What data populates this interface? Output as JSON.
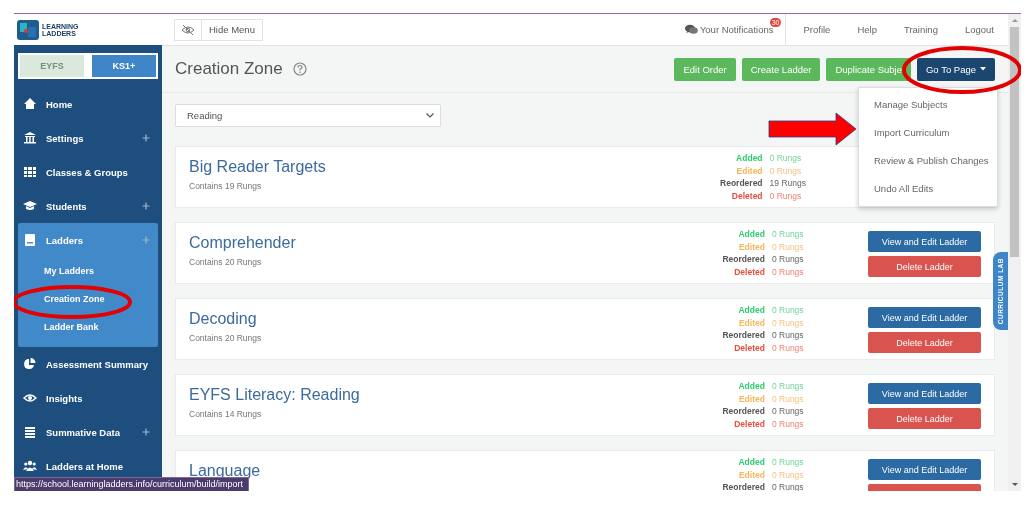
{
  "logo": {
    "line_1": "LEARNING",
    "line_2": "LADDERS"
  },
  "top_bar": {
    "hide_menu": "Hide Menu",
    "notifications": {
      "label": "Your Notifications",
      "count": "30"
    },
    "links": [
      "Profile",
      "Help",
      "Training",
      "Logout"
    ]
  },
  "stage_toggle": [
    {
      "label": "EYFS",
      "selected": false
    },
    {
      "label": "KS1+",
      "selected": true
    }
  ],
  "sidebar": {
    "items": [
      {
        "label": "Home",
        "expandable": false
      },
      {
        "label": "Settings",
        "expandable": true,
        "expanded": false
      },
      {
        "label": "Classes & Groups",
        "expandable": false
      },
      {
        "label": "Students",
        "expandable": true,
        "expanded": false
      },
      {
        "label": "Ladders",
        "expandable": true,
        "expanded": true,
        "children": [
          {
            "label": "My Ladders"
          },
          {
            "label": "Creation Zone"
          },
          {
            "label": "Ladder Bank"
          }
        ]
      },
      {
        "label": "Assessment Summary",
        "expandable": false
      },
      {
        "label": "Insights",
        "expandable": false
      },
      {
        "label": "Summative Data",
        "expandable": true,
        "expanded": false
      },
      {
        "label": "Ladders at Home",
        "expandable": false
      }
    ]
  },
  "page": {
    "title": "Creation Zone",
    "subject_select": "Reading",
    "actions": [
      {
        "kind": "green",
        "label": "Edit Order"
      },
      {
        "kind": "green",
        "label": "Create Ladder"
      },
      {
        "kind": "green",
        "label": "Duplicate Subje"
      }
    ],
    "go_to_page": {
      "label": "Go To Page",
      "expanded": true,
      "menu": [
        "Manage Subjects",
        "Import Curriculum",
        "Review & Publish Changes",
        "Undo All Edits"
      ]
    }
  },
  "ladders": [
    {
      "name": "Big Reader Targets",
      "rungs": "Contains 19 Rungs",
      "stats": [
        {
          "kind": "added",
          "label": "Added",
          "value": "0 Rungs"
        },
        {
          "kind": "edited",
          "label": "Edited",
          "value": "0 Rungs"
        },
        {
          "kind": "reordered",
          "label": "Reordered",
          "value": "19 Rungs"
        },
        {
          "kind": "deleted",
          "label": "Deleted",
          "value": "0 Rungs"
        }
      ]
    },
    {
      "name": "Comprehender",
      "rungs": "Contains 20 Rungs",
      "stats": [
        {
          "kind": "added",
          "label": "Added",
          "value": "0 Rungs"
        },
        {
          "kind": "edited",
          "label": "Edited",
          "value": "0 Rungs"
        },
        {
          "kind": "reordered",
          "label": "Reordered",
          "value": "0 Rungs"
        },
        {
          "kind": "deleted",
          "label": "Deleted",
          "value": "0 Rungs"
        }
      ],
      "buttons": [
        {
          "kind": "view",
          "label": "View and Edit Ladder"
        },
        {
          "kind": "delete",
          "label": "Delete Ladder"
        }
      ]
    },
    {
      "name": "Decoding",
      "rungs": "Contains 20 Rungs",
      "stats": [
        {
          "kind": "added",
          "label": "Added",
          "value": "0 Rungs"
        },
        {
          "kind": "edited",
          "label": "Edited",
          "value": "0 Rungs"
        },
        {
          "kind": "reordered",
          "label": "Reordered",
          "value": "0 Rungs"
        },
        {
          "kind": "deleted",
          "label": "Deleted",
          "value": "0 Rungs"
        }
      ],
      "buttons": [
        {
          "kind": "view",
          "label": "View and Edit Ladder"
        },
        {
          "kind": "delete",
          "label": "Delete Ladder"
        }
      ]
    },
    {
      "name": "EYFS Literacy: Reading",
      "rungs": "Contains 14 Rungs",
      "stats": [
        {
          "kind": "added",
          "label": "Added",
          "value": "0 Rungs"
        },
        {
          "kind": "edited",
          "label": "Edited",
          "value": "0 Rungs"
        },
        {
          "kind": "reordered",
          "label": "Reordered",
          "value": "0 Rungs"
        },
        {
          "kind": "deleted",
          "label": "Deleted",
          "value": "0 Rungs"
        }
      ],
      "buttons": [
        {
          "kind": "view",
          "label": "View and Edit Ladder"
        },
        {
          "kind": "delete",
          "label": "Delete Ladder"
        }
      ]
    },
    {
      "name": "Language",
      "stats": [
        {
          "kind": "added",
          "label": "Added",
          "value": "0 Rungs"
        },
        {
          "kind": "edited",
          "label": "Edited",
          "value": "0 Rungs"
        },
        {
          "kind": "reordered",
          "label": "Reordered",
          "value": "0 Rungs"
        }
      ],
      "buttons": [
        {
          "kind": "view",
          "label": "View and Edit Ladder"
        }
      ]
    }
  ],
  "side_tab": "CURRICULUM LAB",
  "status_url": "https://school.learningladders.info/curriculum/build/import"
}
